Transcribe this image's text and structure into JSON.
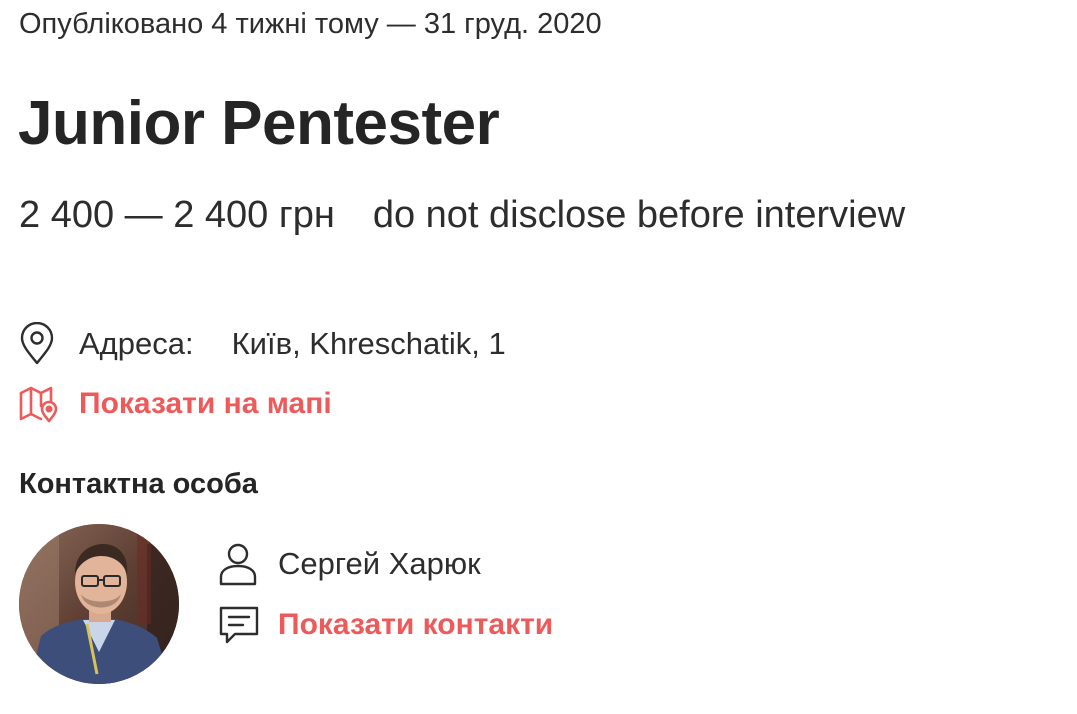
{
  "published": "Опубліковано 4 тижні тому — 31 груд. 2020",
  "job": {
    "title": "Junior Pentester",
    "salary": "2 400 — 2 400 грн",
    "salary_note": "do not disclose before interview"
  },
  "address": {
    "icon": "location-pin-icon",
    "label": "Адреса:",
    "value": "Київ, Khreschatik, 1"
  },
  "map": {
    "icon": "map-icon",
    "link_label": "Показати на мапі"
  },
  "contact": {
    "heading": "Контактна особа",
    "icon_person": "person-icon",
    "name": "Сергей Харюк",
    "icon_chat": "chat-icon",
    "show_contacts_label": "Показати контакти"
  },
  "colors": {
    "text": "#2d2d2d",
    "heading": "#252525",
    "accent": "#ee5a5a"
  }
}
